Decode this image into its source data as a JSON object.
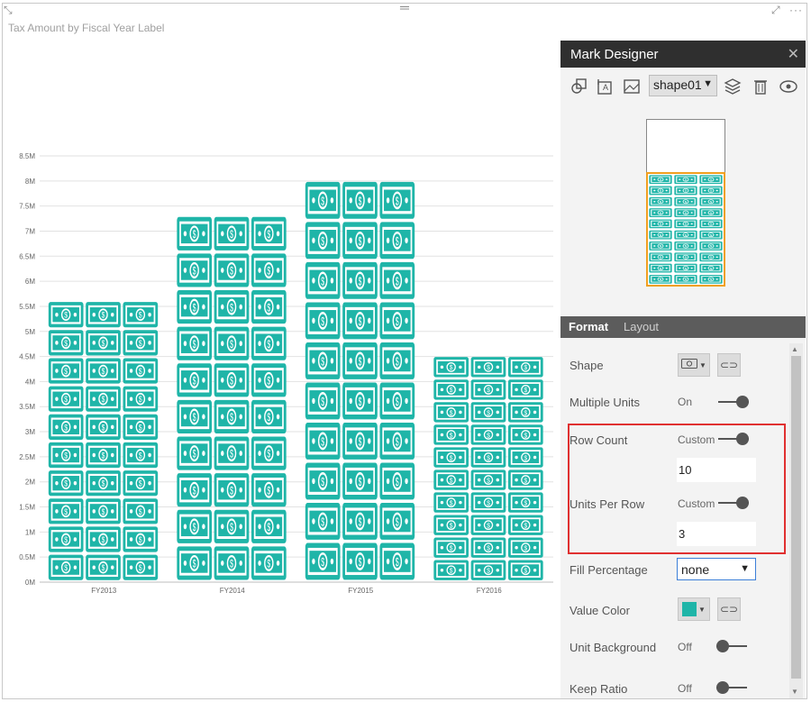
{
  "visual": {
    "title": "Tax Amount by Fiscal Year Label",
    "focus_icon": "focus-mode-icon",
    "more_icon": "more-options-icon"
  },
  "chart_data": {
    "type": "bar",
    "title": "Tax Amount by Fiscal Year Label",
    "categories": [
      "FY2013",
      "FY2014",
      "FY2015",
      "FY2016"
    ],
    "values": [
      5.6,
      7.3,
      8.0,
      4.5
    ],
    "value_unit": "M",
    "ylim": [
      0,
      8.5
    ],
    "yticks": [
      "0M",
      "0.5M",
      "1M",
      "1.5M",
      "2M",
      "2.5M",
      "3M",
      "3.5M",
      "4M",
      "4.5M",
      "5M",
      "5.5M",
      "6M",
      "6.5M",
      "7M",
      "7.5M",
      "8M",
      "8.5M"
    ],
    "grid": true,
    "mark_color": "#1fb5a8",
    "units_per_row": 3,
    "row_count": 10,
    "mark_icon": "dollar-bill-icon"
  },
  "mark_designer": {
    "title": "Mark Designer",
    "close_icon": "close-icon",
    "toolbar": {
      "shape_icon": "add-shape-icon",
      "text_icon": "add-text-icon",
      "image_icon": "add-image-icon",
      "selected_shape": "shape01",
      "layers_icon": "layers-icon",
      "delete_icon": "delete-icon",
      "visibility_icon": "eye-icon"
    },
    "tabs": [
      "Format",
      "Layout"
    ],
    "properties": {
      "shape": {
        "label": "Shape"
      },
      "multiple_units": {
        "label": "Multiple Units",
        "state": "On"
      },
      "row_count": {
        "label": "Row Count",
        "mode": "Custom",
        "value": "10"
      },
      "units_per_row": {
        "label": "Units Per Row",
        "mode": "Custom",
        "value": "3"
      },
      "fill_percentage": {
        "label": "Fill Percentage",
        "value": "none"
      },
      "value_color": {
        "label": "Value Color",
        "color": "#1fb5a8"
      },
      "unit_background": {
        "label": "Unit Background",
        "state": "Off"
      },
      "keep_ratio": {
        "label": "Keep Ratio",
        "state": "Off"
      }
    }
  }
}
